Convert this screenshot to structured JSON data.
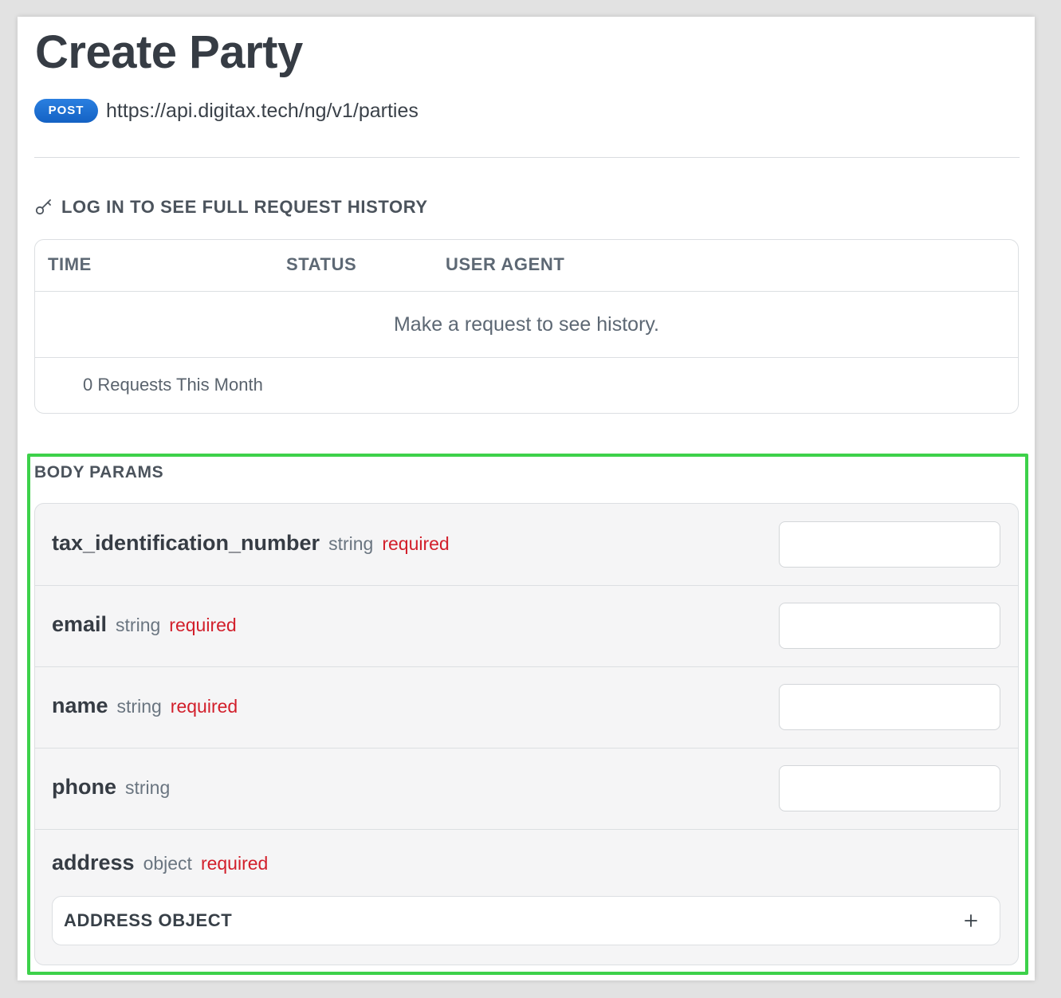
{
  "page": {
    "title": "Create Party",
    "method": "POST",
    "url": "https://api.digitax.tech/ng/v1/parties"
  },
  "history": {
    "login_prompt": "LOG IN TO SEE FULL REQUEST HISTORY",
    "columns": [
      "TIME",
      "STATUS",
      "USER AGENT"
    ],
    "empty_message": "Make a request to see history.",
    "count_text": "0 Requests This Month"
  },
  "body_params": {
    "heading": "BODY PARAMS",
    "params": [
      {
        "name": "tax_identification_number",
        "type": "string",
        "required": "required",
        "value": ""
      },
      {
        "name": "email",
        "type": "string",
        "required": "required",
        "value": ""
      },
      {
        "name": "name",
        "type": "string",
        "required": "required",
        "value": ""
      },
      {
        "name": "phone",
        "type": "string",
        "required": "",
        "value": ""
      }
    ],
    "address": {
      "name": "address",
      "type": "object",
      "required": "required",
      "object_label": "ADDRESS OBJECT"
    }
  },
  "colors": {
    "method_badge": "#1f6fd0",
    "required_text": "#d21f2b",
    "highlight_border": "#3dd14a"
  },
  "icons": {
    "login": "key-icon",
    "expand": "plus-icon"
  }
}
